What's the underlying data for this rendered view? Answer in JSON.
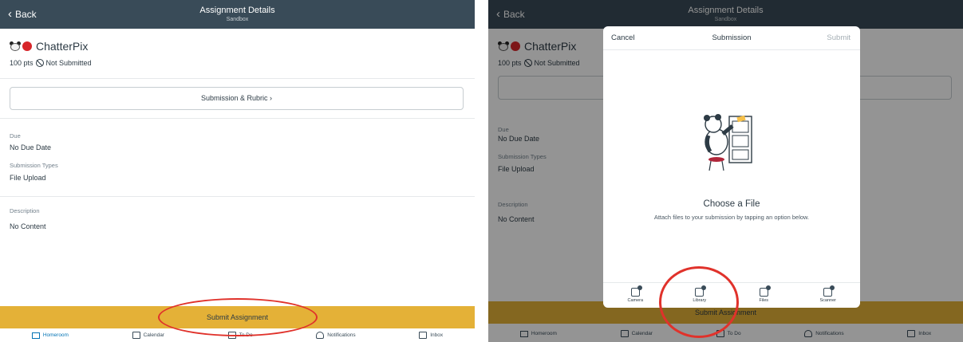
{
  "header": {
    "back_label": "Back",
    "title": "Assignment Details",
    "subtitle": "Sandbox"
  },
  "assignment": {
    "name": "ChatterPix",
    "points": "100 pts",
    "status": "Not Submitted"
  },
  "rubric_button": "Submission & Rubric",
  "details": {
    "due_label": "Due",
    "due_value": "No Due Date",
    "types_label": "Submission Types",
    "types_value": "File Upload",
    "desc_label": "Description",
    "desc_value": "No Content"
  },
  "submit_label": "Submit Assignment",
  "tabs": [
    {
      "label": "Homeroom",
      "icon": "home-icon"
    },
    {
      "label": "Calendar",
      "icon": "calendar-icon"
    },
    {
      "label": "To Do",
      "icon": "todo-icon"
    },
    {
      "label": "Notifications",
      "icon": "bell-icon"
    },
    {
      "label": "Inbox",
      "icon": "inbox-icon"
    }
  ],
  "modal": {
    "cancel": "Cancel",
    "title": "Submission",
    "submit": "Submit",
    "heading": "Choose a File",
    "message": "Attach files to your submission by tapping an option below.",
    "options": [
      {
        "label": "Camera",
        "icon": "camera-icon"
      },
      {
        "label": "Library",
        "icon": "library-icon"
      },
      {
        "label": "Files",
        "icon": "files-icon"
      },
      {
        "label": "Scanner",
        "icon": "scanner-icon"
      }
    ]
  },
  "colors": {
    "nav": "#394b58",
    "submit": "#e4b137",
    "annotation": "#e0322b"
  }
}
